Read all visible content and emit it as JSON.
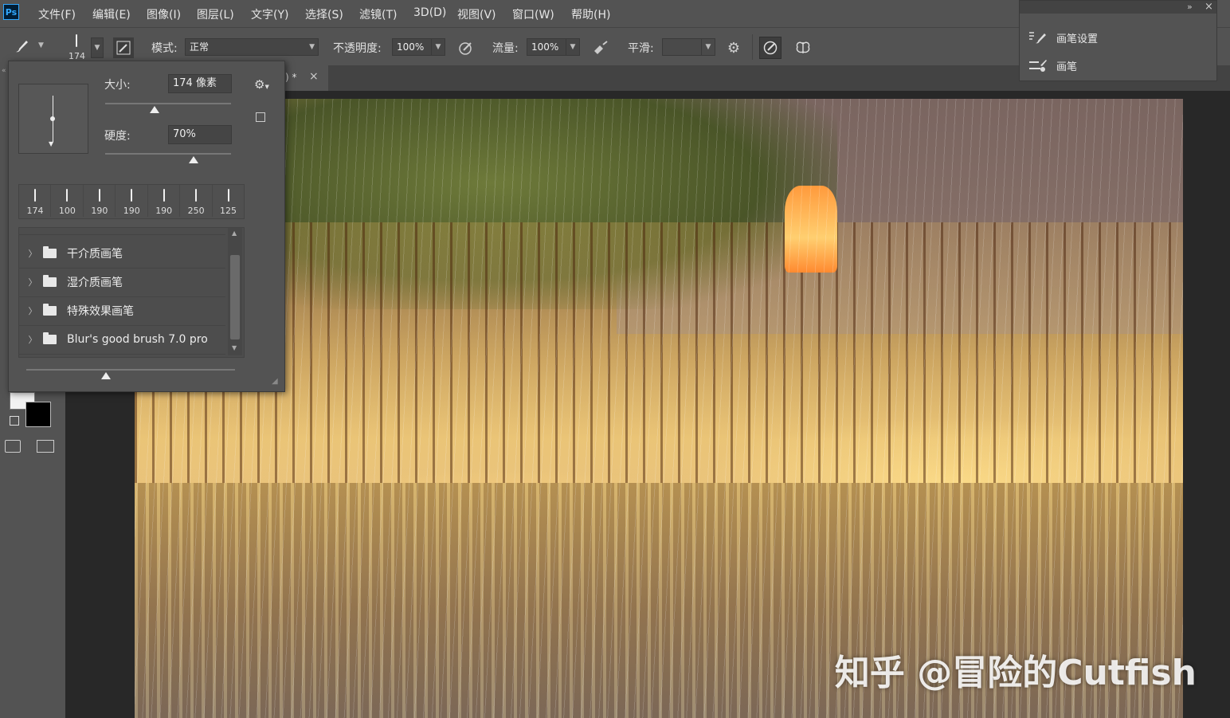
{
  "app": {
    "logo": "Ps"
  },
  "menu": [
    "文件(F)",
    "编辑(E)",
    "图像(I)",
    "图层(L)",
    "文字(Y)",
    "选择(S)",
    "滤镜(T)",
    "3D(D)",
    "视图(V)",
    "窗口(W)",
    "帮助(H)"
  ],
  "options": {
    "brush_size_readout": "174",
    "mode_label": "模式:",
    "mode_value": "正常",
    "opacity_label": "不透明度:",
    "opacity_value": "100%",
    "flow_label": "流量:",
    "flow_value": "100%",
    "smoothing_label": "平滑:",
    "smoothing_value": ""
  },
  "doc_tab": {
    "title_fragment": ") *",
    "close": "×"
  },
  "brush_picker": {
    "size_label": "大小:",
    "size_value": "174 像素",
    "size_level": 0.39,
    "hardness_label": "硬度:",
    "hardness_value": "70%",
    "hardness_level": 0.7,
    "presets": [
      "174",
      "100",
      "190",
      "190",
      "190",
      "250",
      "125"
    ],
    "folders": [
      "干介质画笔",
      "湿介质画笔",
      "特殊效果画笔",
      "Blur's good brush 7.0 pro"
    ],
    "preview_scale_level": 0.38
  },
  "right_panel": {
    "items": [
      "画笔设置",
      "画笔"
    ],
    "close": "×",
    "collapse": "»"
  },
  "canvas": {
    "watermark": "知乎 @冒险的Cutfish"
  },
  "icons": [
    "brush-icon",
    "brush-settings-icon",
    "airbrush-icon",
    "pressure-icon",
    "gear-icon",
    "symmetry-icon",
    "folder-icon",
    "chevron-right-icon"
  ]
}
